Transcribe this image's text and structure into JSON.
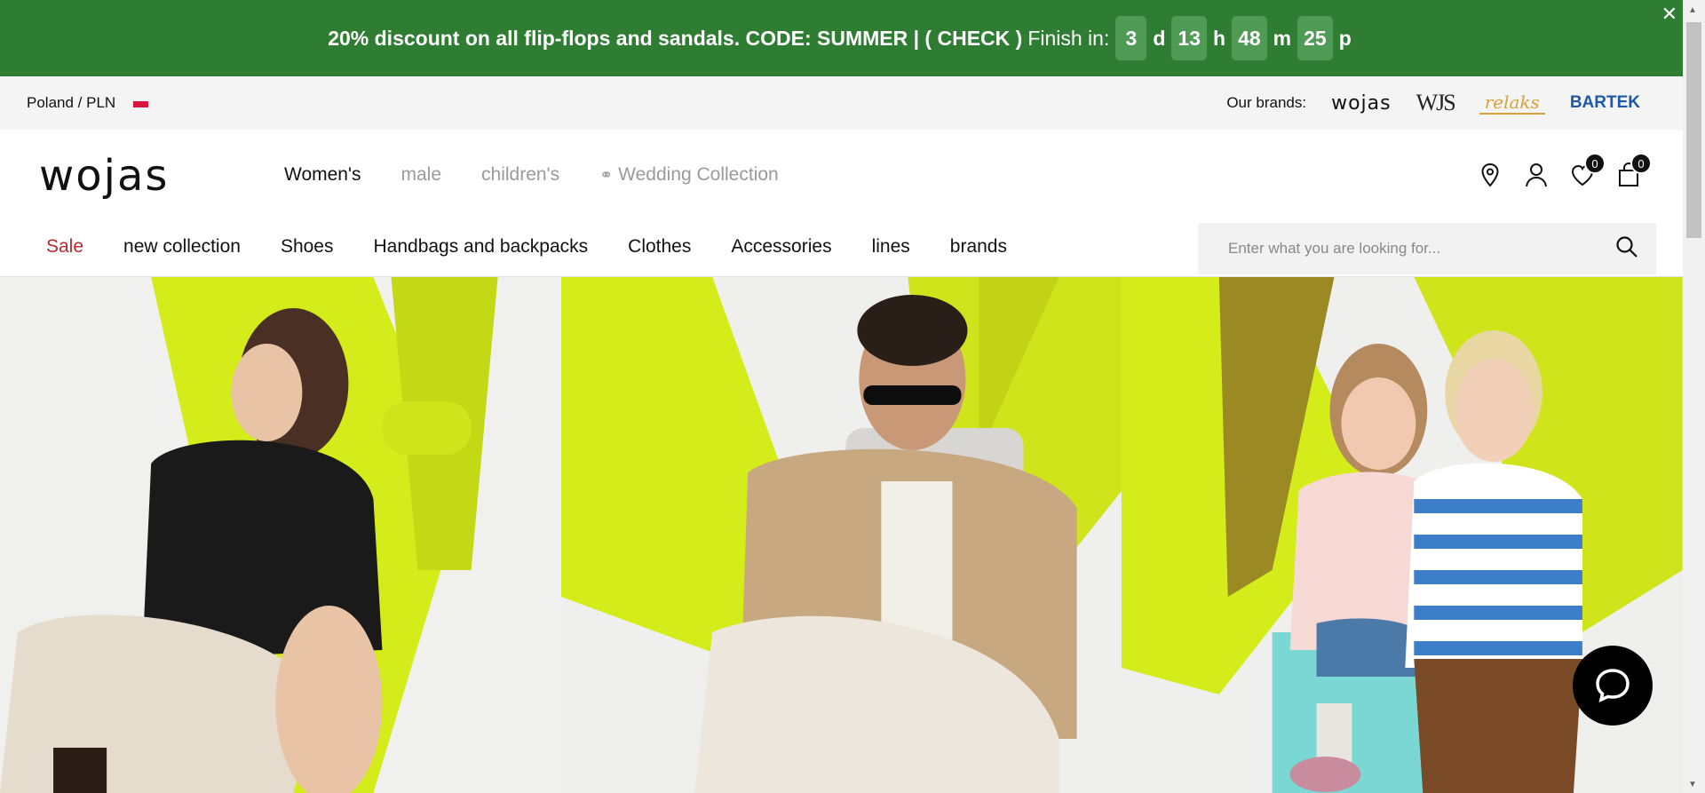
{
  "promo": {
    "text": "20% discount on all flip-flops and sandals. CODE: SUMMER | ( CHECK )",
    "finish_label": "Finish in:",
    "days": "3",
    "days_unit": "d",
    "hours": "13",
    "hours_unit": "h",
    "minutes": "48",
    "minutes_unit": "m",
    "seconds": "25",
    "seconds_unit": "p",
    "close": "✕",
    "bg_color": "#2e7d32"
  },
  "util": {
    "region": "Poland / PLN",
    "brands_label": "Our brands:",
    "brands": [
      "wojas",
      "WJS",
      "relaks",
      "BARTEK"
    ]
  },
  "header": {
    "logo": "wojas",
    "categories": [
      "Women's",
      "male",
      "children's",
      "Wedding Collection"
    ]
  },
  "icons": {
    "location": "location-pin-icon",
    "account": "user-icon",
    "wishlist_count": "0",
    "cart_count": "0"
  },
  "nav": [
    "Sale",
    "new collection",
    "Shoes",
    "Handbags and backpacks",
    "Clothes",
    "Accessories",
    "lines",
    "brands"
  ],
  "search": {
    "placeholder": "Enter what you are looking for..."
  },
  "colors": {
    "sale": "#c0262d",
    "accent_lime": "#d4ec1a",
    "badge": "#111111"
  }
}
